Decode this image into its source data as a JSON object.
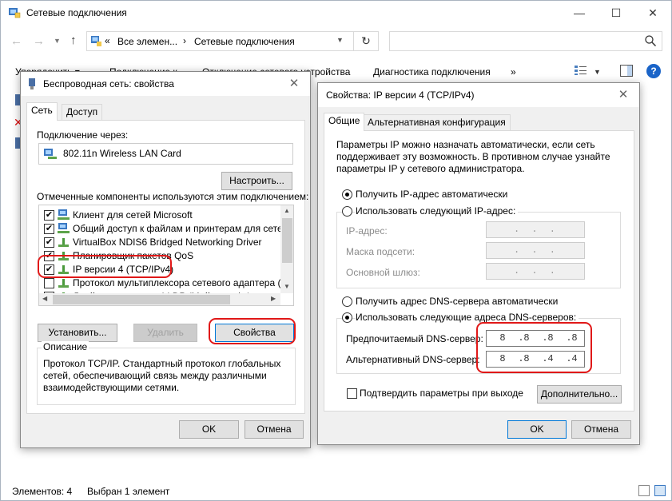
{
  "explorer": {
    "title": "Сетевые подключения",
    "breadcrumb_prefix": "«",
    "breadcrumb_1": "Все элемен...",
    "breadcrumb_sep": "›",
    "breadcrumb_2": "Сетевые подключения",
    "search_placeholder": "",
    "commands": [
      "Упорядочить ▾",
      "Подключение к",
      "Отключение сетевого устройства",
      "Диагностика подключения",
      "»"
    ],
    "status_items": "Элементов: 4",
    "status_selected": "Выбран 1 элемент"
  },
  "wireless_dialog": {
    "title": "Беспроводная сеть: свойства",
    "tabs": [
      "Сеть",
      "Доступ"
    ],
    "connect_through_label": "Подключение через:",
    "adapter_name": "802.11n Wireless LAN Card",
    "configure_button": "Настроить...",
    "components_label": "Отмеченные компоненты используются этим подключением:",
    "components": [
      {
        "label": "Клиент для сетей Microsoft",
        "checked": true
      },
      {
        "label": "Общий доступ к файлам и принтерам для сетей Mi",
        "checked": true
      },
      {
        "label": "VirtualBox NDIS6 Bridged Networking Driver",
        "checked": true
      },
      {
        "label": "Планировщик пакетов QoS",
        "checked": true
      },
      {
        "label": "IP версии 4 (TCP/IPv4)",
        "checked": true
      },
      {
        "label": "Протокол мультиплексора сетевого адаптера (Май",
        "checked": false
      },
      {
        "label": "Драйвер протокола LLDP (Майкрософт)",
        "checked": true
      }
    ],
    "install_button": "Установить...",
    "remove_button": "Удалить",
    "properties_button": "Свойства",
    "description_label": "Описание",
    "description_text": [
      "Протокол TCP/IP. Стандартный протокол глобальных",
      "сетей, обеспечивающий связь между различными",
      "взаимодействующими сетями."
    ],
    "ok_button": "OK",
    "cancel_button": "Отмена"
  },
  "ipv4_dialog": {
    "title": "Свойства: IP версии 4 (TCP/IPv4)",
    "tabs": [
      "Общие",
      "Альтернативная конфигурация"
    ],
    "intro_text": [
      "Параметры IP можно назначать автоматически, если сеть",
      "поддерживает эту возможность. В противном случае узнайте",
      "параметры IP у сетевого администратора."
    ],
    "auto_ip_label": "Получить IP-адрес автоматически",
    "manual_ip_label": "Использовать следующий IP-адрес:",
    "ip_address_label": "IP-адрес:",
    "subnet_label": "Маска подсети:",
    "gateway_label": "Основной шлюз:",
    "auto_dns_label": "Получить адрес DNS-сервера автоматически",
    "manual_dns_label": "Использовать следующие адреса DNS-серверов:",
    "preferred_dns_label": "Предпочитаемый DNS-сервер:",
    "preferred_dns": [
      "8",
      "8",
      "8",
      "8"
    ],
    "alternate_dns_label": "Альтернативный DNS-сервер:",
    "alternate_dns": [
      "8",
      "8",
      "4",
      "4"
    ],
    "ip_placeholder": ".   .   .",
    "validate_label": "Подтвердить параметры при выходе",
    "advanced_button": "Дополнительно...",
    "ok_button": "OK",
    "cancel_button": "Отмена"
  },
  "colors": {
    "highlight": "#e01818",
    "accent": "#0078d7"
  }
}
